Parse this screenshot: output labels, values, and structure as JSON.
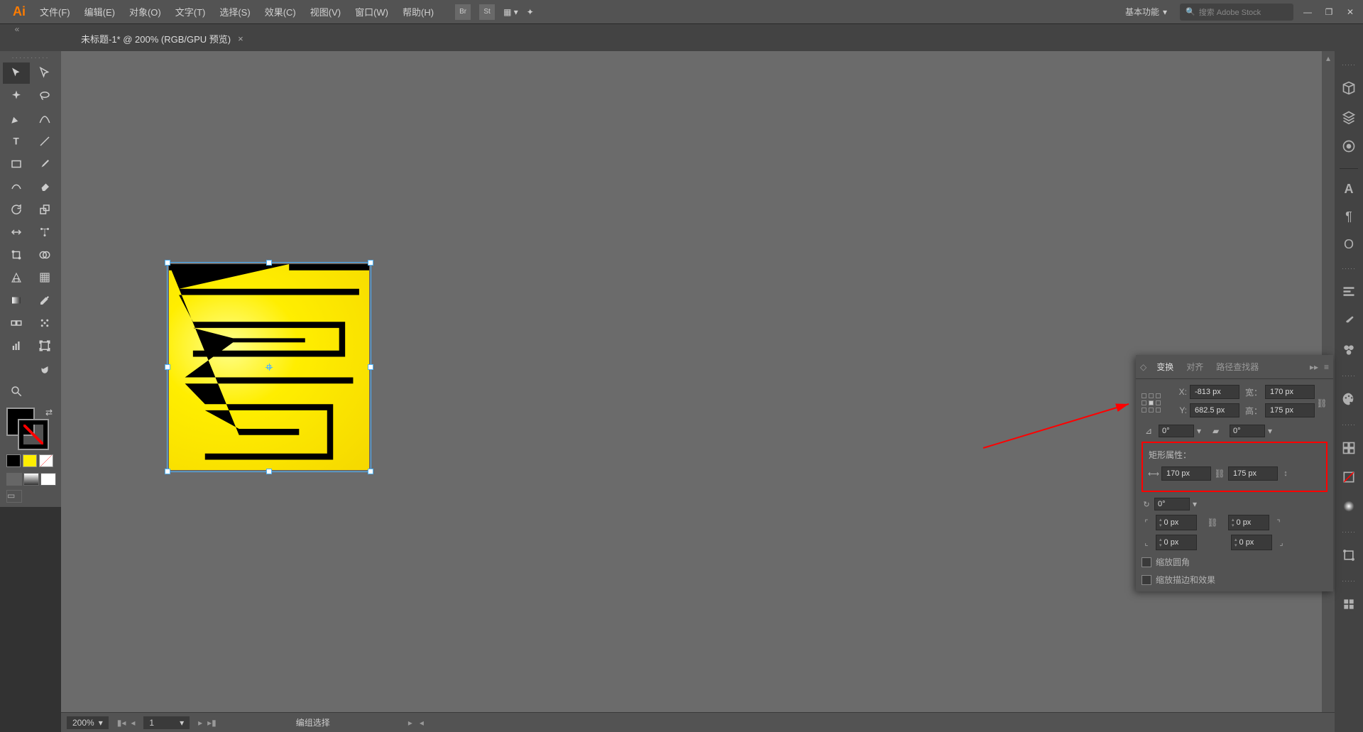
{
  "app": {
    "logo": "Ai"
  },
  "menu": {
    "file": "文件(F)",
    "edit": "编辑(E)",
    "object": "对象(O)",
    "type": "文字(T)",
    "select": "选择(S)",
    "effect": "效果(C)",
    "view": "视图(V)",
    "window": "窗口(W)",
    "help": "帮助(H)"
  },
  "top_icons": {
    "bridge": "Br",
    "stock": "St"
  },
  "workspace": {
    "label": "基本功能"
  },
  "search": {
    "placeholder": "搜索 Adobe Stock"
  },
  "tab": {
    "title": "未标题-1* @ 200% (RGB/GPU 预览)"
  },
  "panel": {
    "transform_tab": "变换",
    "align_tab": "对齐",
    "pathfinder_tab": "路径查找器",
    "x_label": "X:",
    "y_label": "Y:",
    "w_label": "宽：",
    "h_label": "高：",
    "x_value": "-813 px",
    "y_value": "682.5 px",
    "w_value": "170 px",
    "h_value": "175 px",
    "rotate_value": "0°",
    "shear_value": "0°",
    "rect_props_label": "矩形属性：",
    "rect_w": "170 px",
    "rect_h": "175 px",
    "rect_rot": "0°",
    "corner_tl": "0 px",
    "corner_tr": "0 px",
    "corner_bl": "0 px",
    "corner_br": "0 px",
    "scale_corners": "缩放圆角",
    "scale_effects": "缩放描边和效果"
  },
  "status": {
    "zoom": "200%",
    "artboard": "1",
    "selection": "编组选择"
  }
}
